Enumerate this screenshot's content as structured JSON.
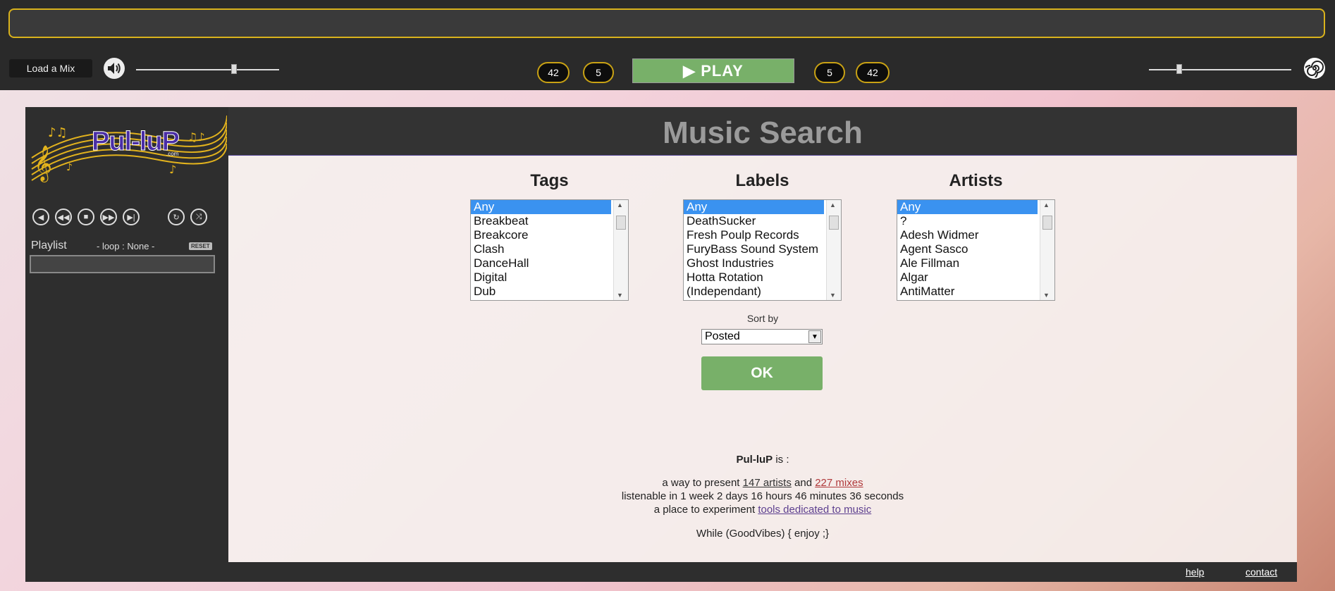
{
  "player": {
    "load_label": "Load a Mix",
    "left_counter_1": "42",
    "left_counter_2": "5",
    "play_label": "▶ PLAY",
    "right_counter_1": "5",
    "right_counter_2": "42"
  },
  "sidebar": {
    "logo_text": "Pul-luP",
    "logo_sub": ".com",
    "playlist_label": "Playlist",
    "loop_label": "- loop : None -",
    "reset_label": "RESET"
  },
  "search": {
    "title": "Music Search",
    "tags": {
      "heading": "Tags",
      "options": [
        "Any",
        "Breakbeat",
        "Breakcore",
        "Clash",
        "DanceHall",
        "Digital",
        "Dub"
      ]
    },
    "labels": {
      "heading": "Labels",
      "options": [
        "Any",
        "DeathSucker",
        "Fresh Poulp Records",
        "FuryBass Sound System",
        "Ghost Industries",
        "Hotta Rotation",
        "(Independant)"
      ]
    },
    "artists": {
      "heading": "Artists",
      "options": [
        "Any",
        "?",
        "Adesh Widmer",
        "Agent Sasco",
        "Ale Fillman",
        "Algar",
        "AntiMatter"
      ]
    },
    "sort_label": "Sort by",
    "sort_value": "Posted",
    "ok_label": "OK"
  },
  "info": {
    "brand": "Pul-luP",
    "is_text": " is :",
    "line1_pre": "a way to present ",
    "artists_link": "147 artists",
    "line1_mid": " and ",
    "mixes_link": "227 mixes",
    "line2": "listenable in 1 week 2 days 16 hours 46 minutes 36 seconds",
    "line3_pre": "a place to experiment ",
    "tools_link": "tools dedicated to music",
    "line4": "While (GoodVibes) { enjoy ;}"
  },
  "footer": {
    "help": "help",
    "contact": "contact"
  },
  "colors": {
    "accent_gold": "#d9b21c",
    "play_green": "#78b069",
    "select_blue": "#3a92f0"
  }
}
